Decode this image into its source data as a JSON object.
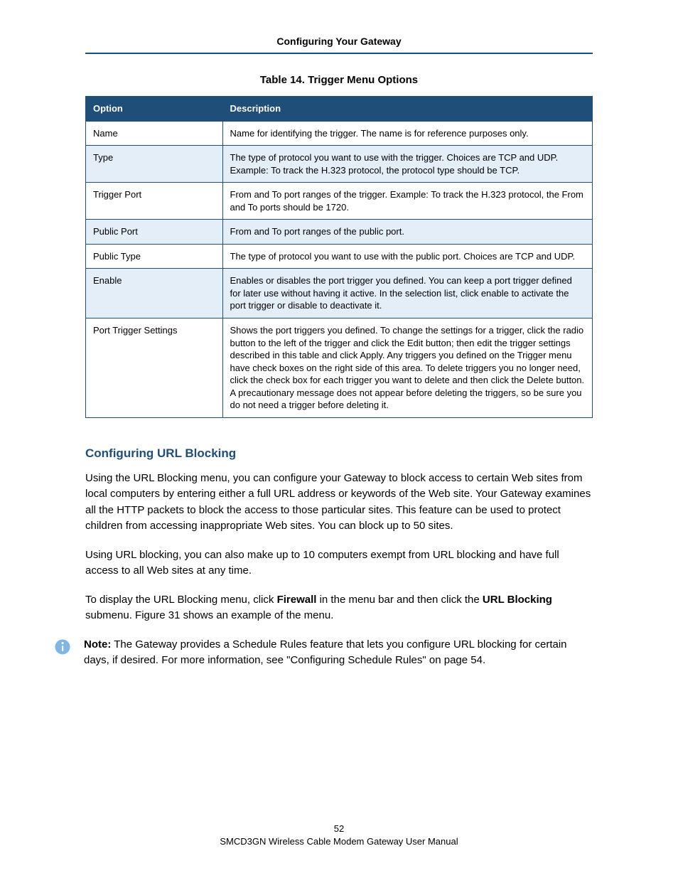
{
  "header": {
    "running_title": "Configuring Your Gateway"
  },
  "table": {
    "caption": "Table 14. Trigger Menu Options",
    "col_option": "Option",
    "col_desc": "Description",
    "rows": [
      {
        "opt": "Name",
        "desc": "Name for identifying the trigger. The name is for reference purposes only."
      },
      {
        "opt": "Type",
        "desc": "The type of protocol you want to use with the trigger. Choices are TCP and UDP. Example: To track the H.323 protocol, the protocol type should be TCP."
      },
      {
        "opt": "Trigger Port",
        "desc": "From and To port ranges of the trigger. Example: To track the H.323 protocol, the From and To ports should be 1720."
      },
      {
        "opt": "Public Port",
        "desc": "From and To port ranges of the public port."
      },
      {
        "opt": "Public Type",
        "desc": "The type of protocol you want to use with the public port. Choices are TCP and UDP."
      },
      {
        "opt": "Enable",
        "desc": "Enables or disables the port trigger you defined. You can keep a port trigger defined for later use without having it active. In the selection list, click enable to activate the port trigger or disable to deactivate it."
      },
      {
        "opt": "Port Trigger Settings",
        "desc": "Shows the port triggers you defined. To change the settings for a trigger, click the radio button to the left of the trigger and click the Edit button; then edit the trigger settings described in this table and click Apply. Any triggers you defined on the Trigger menu have check boxes on the right side of this area. To delete triggers you no longer need, click the check box for each trigger you want to delete and then click the Delete button. A precautionary message does not appear before deleting the triggers, so be sure you do not need a trigger before deleting it."
      }
    ]
  },
  "section": {
    "heading": "Configuring URL Blocking",
    "p1": "Using the URL Blocking menu, you can configure your Gateway to block access to certain Web sites from local computers by entering either a full URL address or keywords of the Web site. Your Gateway examines all the HTTP packets to block the access to those particular sites. This feature can be used to protect children from accessing inappropriate Web sites. You can block up to 50 sites.",
    "p2": "Using URL blocking, you can also make up to 10 computers exempt from URL blocking and have full access to all Web sites at any time.",
    "p3_prefix": "To display the URL Blocking menu, click ",
    "p3_bold1": "Firewall",
    "p3_mid": " in the menu bar and then click the ",
    "p3_bold2": "URL Blocking",
    "p3_suffix": " submenu. Figure 31 shows an example of the menu."
  },
  "note": {
    "label": "Note:",
    "text": " The Gateway provides a Schedule Rules feature that lets you configure URL blocking for certain days, if desired. For more information, see \"Configuring Schedule Rules\" on page 54."
  },
  "footer": {
    "page_number": "52",
    "doc_title": "SMCD3GN Wireless Cable Modem Gateway User Manual"
  }
}
